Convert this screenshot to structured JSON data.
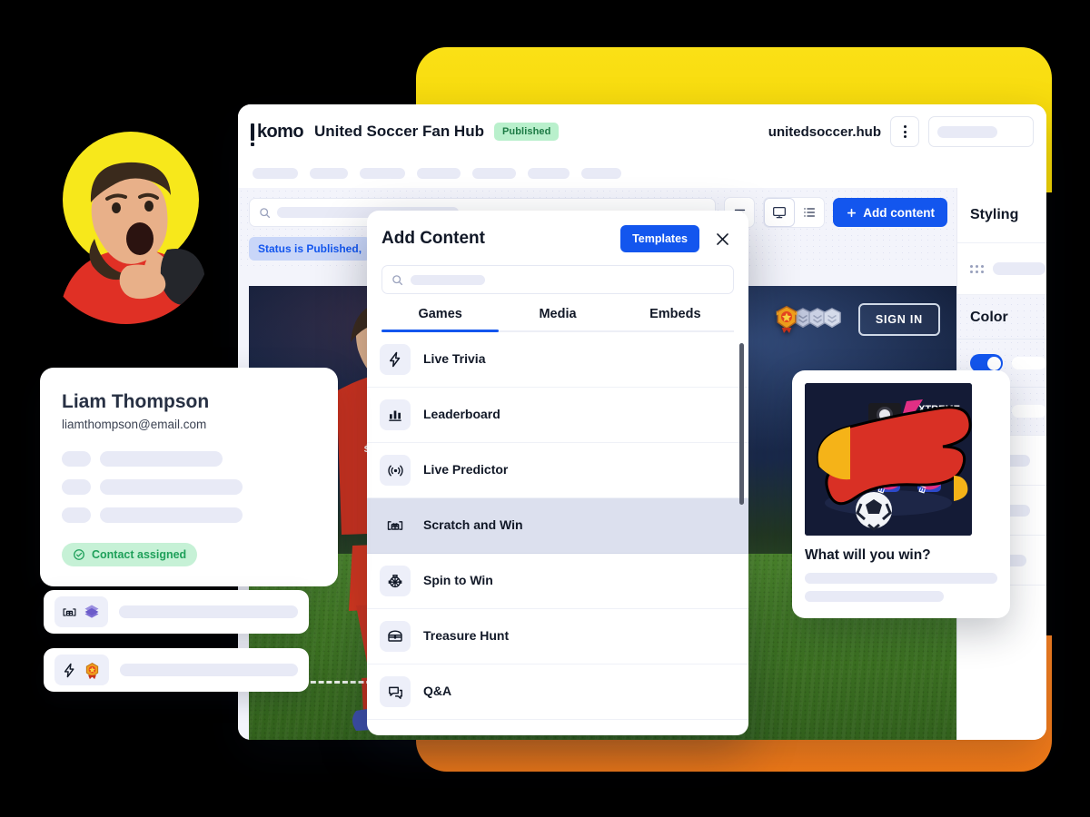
{
  "brand": {
    "logo_text": "komo",
    "accent_blue": "#1356EE",
    "yellow": "#FAE016",
    "orange": "#F98020",
    "green": "#1FA05A"
  },
  "app_header": {
    "hub_title": "United Soccer Fan Hub",
    "status_badge": "Published",
    "hub_url": "unitedsoccer.hub",
    "more_menu_icon": "kebab-menu-icon",
    "nav_item_count": 7
  },
  "toolbar": {
    "search_placeholder": "",
    "filter_icon": "filter-icon",
    "desktop_view_icon": "monitor-icon",
    "list_view_icon": "list-icon",
    "add_content_label": "Add content",
    "add_icon": "plus-icon",
    "filter_chip": "Status is Published,"
  },
  "hub_preview": {
    "sign_in_label": "SIGN IN",
    "rank_badges": [
      "gold-star-badge-icon",
      "silver-chevron-badge-icon",
      "silver-chevron-badge-icon",
      "silver-chevron-badge-icon"
    ],
    "player_image": "soccer-player-photo"
  },
  "styling_panel": {
    "title": "Styling",
    "drag_handle_icon": "drag-handle-icon",
    "color_section_title": "Color",
    "toggles": [
      {
        "name": "toggle-primary",
        "state": "on"
      },
      {
        "name": "toggle-secondary",
        "state": "off"
      }
    ],
    "row_count": 4
  },
  "modal": {
    "title": "Add Content",
    "templates_label": "Templates",
    "close_icon": "close-icon",
    "search_placeholder": "",
    "search_icon": "search-icon",
    "tabs": [
      {
        "label": "Games",
        "active": true
      },
      {
        "label": "Media",
        "active": false
      },
      {
        "label": "Embeds",
        "active": false
      }
    ],
    "items": [
      {
        "label": "Live Trivia",
        "icon": "lightning-bolt-icon",
        "selected": false,
        "sub_width": "84%"
      },
      {
        "label": "Leaderboard",
        "icon": "bar-chart-icon",
        "selected": false,
        "sub_width": "68%"
      },
      {
        "label": "Live Predictor",
        "icon": "broadcast-signal-icon",
        "selected": false,
        "sub_width": "84%"
      },
      {
        "label": "Scratch and Win",
        "icon": "gift-card-icon",
        "selected": true,
        "sub_width": "74%"
      },
      {
        "label": "Spin to Win",
        "icon": "spin-wheel-icon",
        "selected": false,
        "sub_width": "84%"
      },
      {
        "label": "Treasure Hunt",
        "icon": "treasure-chest-icon",
        "selected": false,
        "sub_width": "70%"
      },
      {
        "label": "Q&A",
        "icon": "chat-bubbles-icon",
        "selected": false,
        "sub_width": "84%"
      }
    ]
  },
  "contact_card": {
    "name": "Liam Thompson",
    "email": "liamthompson@email.com",
    "placeholder_rows": [
      {
        "label_width": "32px",
        "value_width": "135px"
      },
      {
        "label_width": "32px",
        "value_width": "157px"
      },
      {
        "label_width": "32px",
        "value_width": "157px"
      }
    ],
    "status_chip": "Contact assigned",
    "status_icon": "check-circle-icon"
  },
  "mini_cards": [
    {
      "icons": [
        "gift-card-icon",
        "purple-layers-emoji"
      ]
    },
    {
      "icons": [
        "lightning-bolt-icon",
        "gold-crown-emoji"
      ]
    }
  ],
  "win_card": {
    "title": "What will you win?",
    "art_label": "XTREME CHARGE",
    "art_items": [
      "energy-drink-can",
      "energy-drink-can",
      "energy-drink-can",
      "soccer-ball",
      "speaker"
    ]
  },
  "avatar": {
    "image": "excited-man-with-phone-photo",
    "backdrop_color": "#F7E81B"
  }
}
